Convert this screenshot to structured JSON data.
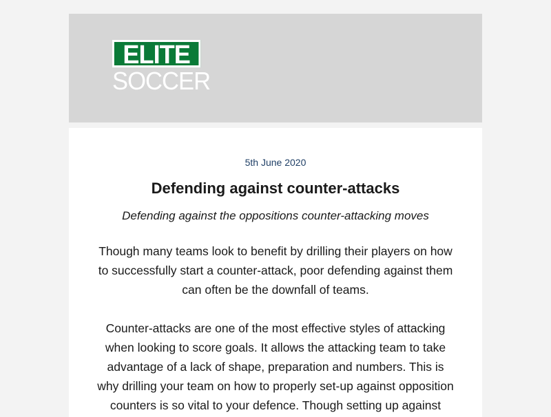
{
  "header": {
    "logo_line1": "ELITE",
    "logo_line2": "SOCCER",
    "brand_green": "#0a7a37",
    "background": "#d6d6d6"
  },
  "article": {
    "date": "5th June 2020",
    "title": "Defending against counter-attacks",
    "subtitle": "Defending against the oppositions counter-attacking moves",
    "paragraphs": [
      "Though many teams look to benefit by drilling their players on how to successfully start a counter-attack, poor defending against them can often be the downfall of teams.",
      "Counter-attacks are one of the most effective styles of attacking when looking to score goals. It allows the attacking team to take advantage of a lack of shape, preparation and numbers. This is why drilling your team on how to properly set-up against opposition counters is so vital to your defence. Though setting up against"
    ]
  }
}
